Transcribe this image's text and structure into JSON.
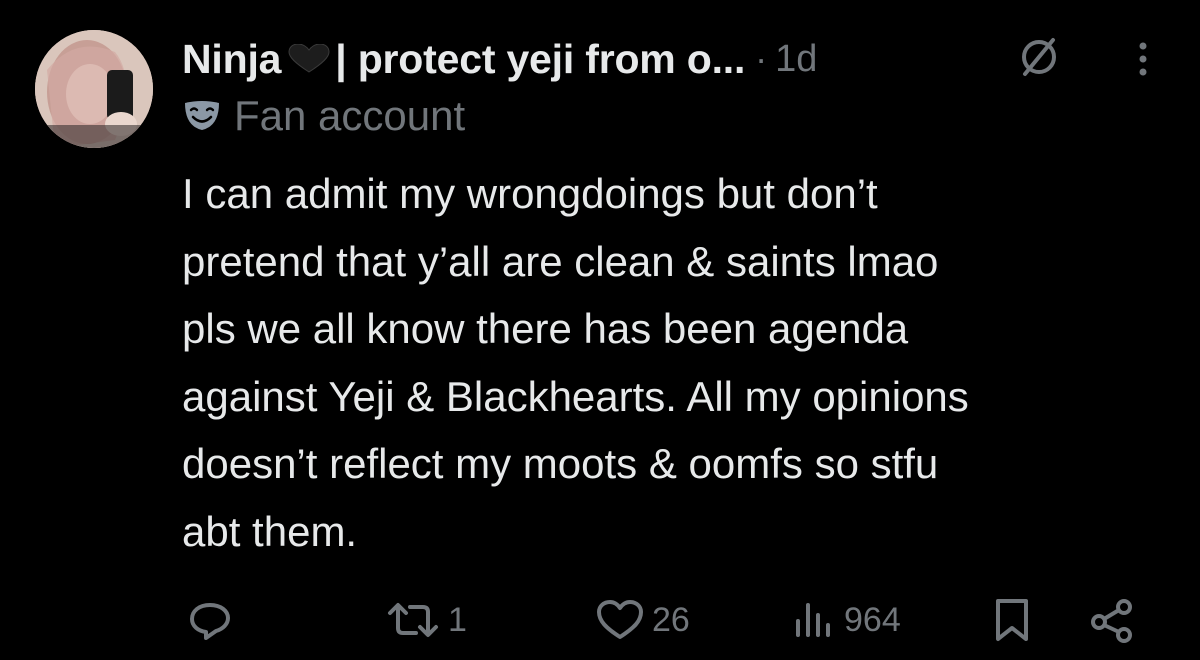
{
  "tweet": {
    "display_name_prefix": "Ninja",
    "display_name_suffix": "| protect yeji from o...",
    "separator": "·",
    "time": "1d",
    "affiliation_label": "Fan account",
    "text_lines": [
      "I can admit my wrongdoings but don’t",
      "pretend that y’all are clean & saints lmao",
      "pls we all know there has been agenda",
      "against Yeji & Blackhearts. All my opinions",
      "doesn’t reflect my moots & oomfs so stfu",
      "abt them."
    ]
  },
  "actions": {
    "reply_count": "",
    "repost_count": "1",
    "like_count": "26",
    "views_count": "964"
  },
  "icons": {
    "avatar": "avatar-photo",
    "heart": "black-heart-icon",
    "hidden": "hidden-reply-icon",
    "more": "more-vertical-icon",
    "mask": "theater-mask-icon",
    "reply": "reply-icon",
    "repost": "repost-icon",
    "like": "heart-outline-icon",
    "views": "views-icon",
    "bookmark": "bookmark-icon",
    "share": "share-icon"
  },
  "colors": {
    "background": "#000000",
    "text_primary": "#e7e9ea",
    "text_secondary": "#71767b"
  }
}
